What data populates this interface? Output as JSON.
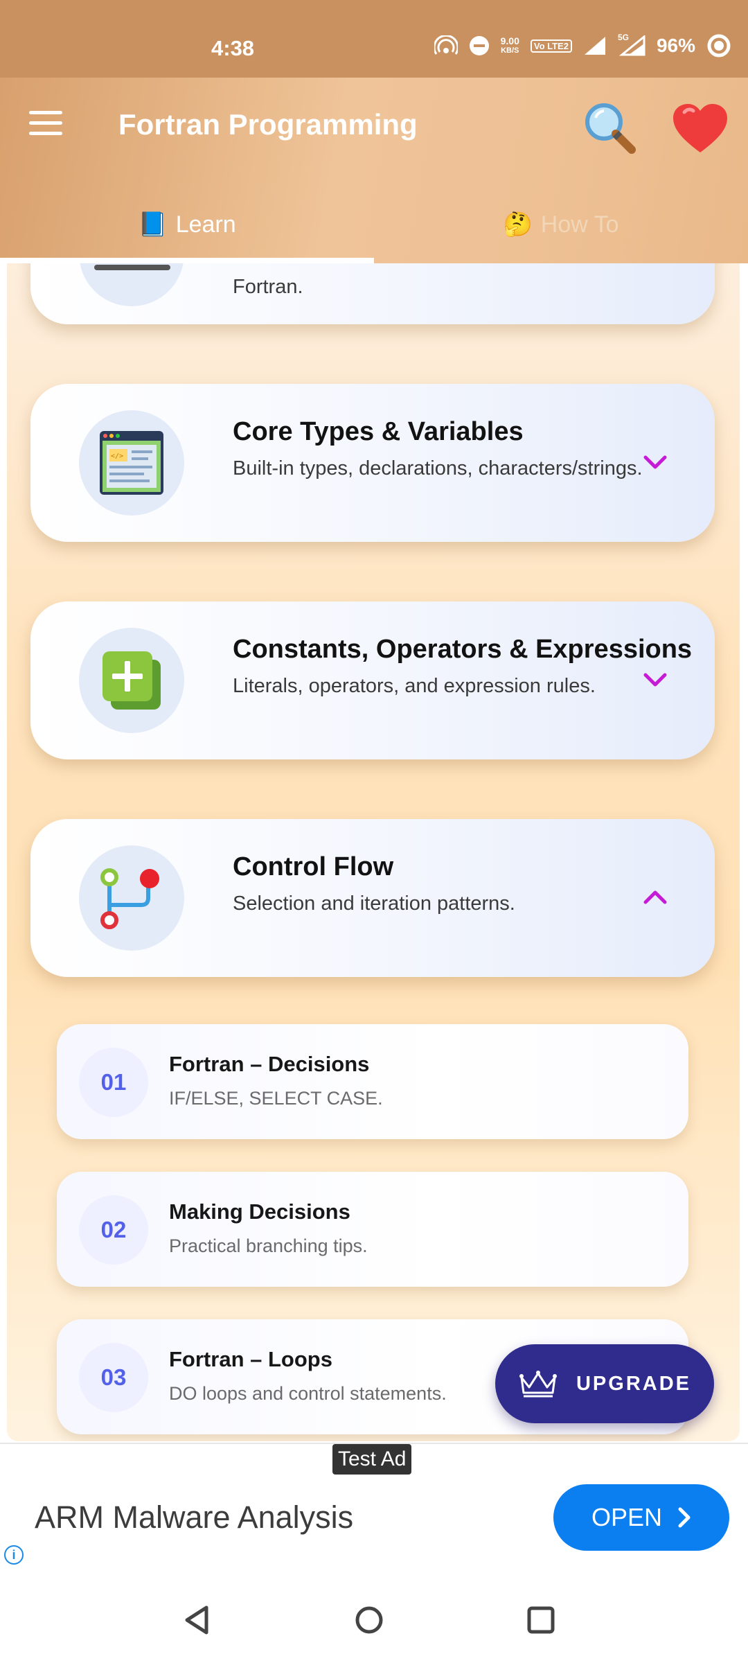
{
  "status_bar": {
    "time": "4:38",
    "net_speed_value": "9.00",
    "net_speed_unit": "KB/S",
    "volte_label": "Vo LTE2",
    "net_label": "5G",
    "battery": "96%",
    "icons": [
      "hotspot-icon",
      "dnd-icon",
      "signal-icon",
      "signal-5g-icon",
      "battery-icon"
    ]
  },
  "app_bar": {
    "title": "Fortran Programming",
    "search_icon": "magnifier-emoji",
    "favorite_icon": "heart-emoji"
  },
  "tabs": [
    {
      "emoji": "📘",
      "label": "Learn",
      "selected": true
    },
    {
      "emoji": "🤔",
      "label": "How To",
      "selected": false
    }
  ],
  "partial_card": {
    "desc": "Fortran."
  },
  "cards": [
    {
      "title": "Core Types & Variables",
      "desc": "Built-in types, declarations, characters/strings.",
      "icon": "code-window-icon",
      "expanded": false
    },
    {
      "title": "Constants, Operators & Expressions",
      "desc": "Literals, operators, and expression rules.",
      "icon": "plus-squares-icon",
      "expanded": false
    },
    {
      "title": "Control Flow",
      "desc": "Selection and iteration patterns.",
      "icon": "branch-flow-icon",
      "expanded": true
    }
  ],
  "sub_items": [
    {
      "num": "01",
      "title": "Fortran – Decisions",
      "desc": "IF/ELSE, SELECT CASE."
    },
    {
      "num": "02",
      "title": "Making Decisions",
      "desc": "Practical branching tips."
    },
    {
      "num": "03",
      "title": "Fortran – Loops",
      "desc": "DO loops and control statements."
    }
  ],
  "upgrade": {
    "label": "UPGRADE",
    "icon": "crown-icon"
  },
  "ad": {
    "tag": "Test Ad",
    "title": "ARM Malware Analysis",
    "cta": "OPEN",
    "info_icon": "i"
  },
  "colors": {
    "status_bar": "#c9915f",
    "accent_chevron": "#c61bd6",
    "upgrade_bg": "#302c8e",
    "ad_button": "#0b7ff0",
    "number_text": "#5360e8"
  }
}
